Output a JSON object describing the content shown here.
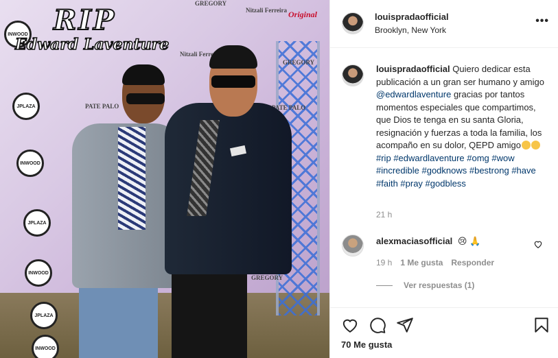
{
  "photo": {
    "overlay_title": "RIP",
    "overlay_name": "Edward Laventure",
    "backdrop_logos": [
      "INWOOD",
      "JPLAZA",
      "INWOOD",
      "JPLAZA",
      "INWOOD",
      "JPLAZA",
      "INWOOD"
    ],
    "backdrop_text_1": "Nitzali Ferreira",
    "backdrop_text_2": "GREGORY",
    "backdrop_text_3": "PATE PALO",
    "backdrop_text_4": "Original"
  },
  "header": {
    "username": "louispradaofficial",
    "location": "Brooklyn, New York",
    "more_icon": "more-horizontal-icon",
    "more_glyph": "•••"
  },
  "caption": {
    "username": "louispradaofficial",
    "text_1": "Quiero dedicar esta publicación a un gran ser humano y amigo",
    "mention": "@edwardlaventure",
    "text_2": "gracias por tantos momentos especiales que compartimos, que Dios te tenga en su santa Gloria, resignación y fuerzas a toda la familia, los acompaño en su dolor, QEPD amigo",
    "hashtags_1": "#rip",
    "hashtags_2": "#edwardlaventure #omg #wow",
    "hashtags_3": "#incredible #godknows #bestrong",
    "hashtags_4": "#have #faith #pray #godbless",
    "time": "21 h"
  },
  "comment": {
    "username": "alexmaciasofficial",
    "text": "😢 🙏",
    "time": "19 h",
    "likes": "1 Me gusta",
    "reply": "Responder",
    "view_replies": "Ver respuestas (1)"
  },
  "actions": {
    "like_icon": "heart-icon",
    "comment_icon": "comment-icon",
    "share_icon": "share-icon",
    "save_icon": "bookmark-icon",
    "likes_count": "70 Me gusta"
  },
  "colors": {
    "link": "#00376b",
    "secondary_text": "#8e8e8e",
    "border": "#efefef"
  }
}
